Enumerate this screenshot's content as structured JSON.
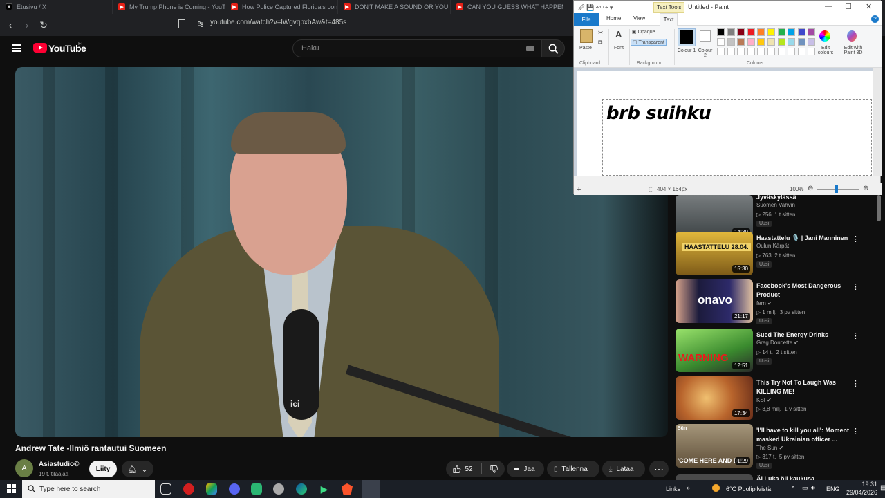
{
  "browser": {
    "tabs": [
      {
        "icon": "x-logo-icon",
        "title": "Etusivu / X"
      },
      {
        "icon": "youtube-icon",
        "title": "My Trump Phone is Coming - YouTu"
      },
      {
        "icon": "youtube-icon",
        "title": "How Police Captured Florida's Long"
      },
      {
        "icon": "youtube-icon",
        "title": "DON'T MAKE A SOUND OR YOU DIE"
      },
      {
        "icon": "youtube-icon",
        "title": "CAN YOU GUESS WHAT HAPPENS N"
      }
    ],
    "url": "youtube.com/watch?v=lWgvqpxbAw&t=485s"
  },
  "youtube": {
    "logo_text": "YouTube",
    "country": "FI",
    "search_placeholder": "Haku",
    "video": {
      "title": "Andrew Tate -Ilmiö rantautui Suomeen",
      "channel": "Asiastudio©",
      "subscribers": "19 t. tilaajaa",
      "join_label": "Liity",
      "likes": "52",
      "share_label": "Jaa",
      "save_label": "Tallenna",
      "download_label": "Lataa",
      "video_logo": "ici"
    },
    "sidebar": [
      {
        "title": "Jyväskylässä",
        "channel": "Suomen Vahvin",
        "views": "256",
        "age": "1 t sitten",
        "duration": "14:39",
        "badge": "Uusi",
        "verified": false,
        "thumb": "#5e6466"
      },
      {
        "title": "Haastattelu 🎙️ | Jani Manninen",
        "channel": "Oulun Kärpät",
        "views": "763",
        "age": "2 t sitten",
        "duration": "15:30",
        "badge": "Uusi",
        "verified": false,
        "thumb": "#c79b2b",
        "thumb_text": "HAASTATTELU 28.04."
      },
      {
        "title": "Facebook's Most Dangerous Product",
        "channel": "fern",
        "views": "1 milj.",
        "age": "3 pv sitten",
        "duration": "21:17",
        "badge": "Uusi",
        "verified": true,
        "thumb": "#1c1b3c",
        "thumb_text": "onavo"
      },
      {
        "title": "Sued The Energy Drinks",
        "channel": "Greg Doucette",
        "views": "14 t.",
        "age": "2 t sitten",
        "duration": "12:51",
        "badge": "Uusi",
        "verified": true,
        "thumb": "#5fb84a",
        "thumb_text": "WARNING"
      },
      {
        "title": "This Try Not To Laugh Was KILLING ME!",
        "channel": "KSI",
        "views": "3,8 milj.",
        "age": "1 v sitten",
        "duration": "17:34",
        "badge": "",
        "verified": true,
        "thumb": "#d8a340"
      },
      {
        "title": "'I'll have to kill you all': Moment masked Ukrainian officer ...",
        "channel": "The Sun",
        "views": "317 t.",
        "age": "5 pv sitten",
        "duration": "1:29",
        "badge": "Uusi",
        "verified": true,
        "thumb": "#7d6a4f",
        "thumb_text": "'COME HERE AND DIE",
        "thumb_label": "Sün"
      },
      {
        "title": "Äl Luka öli kaukusa",
        "channel": "",
        "views": "",
        "age": "",
        "duration": "",
        "badge": "",
        "verified": false,
        "thumb": "#4a4a4a"
      }
    ]
  },
  "paint": {
    "window_title": "Untitled - Paint",
    "context_tab": "Text Tools",
    "tabs": {
      "file": "File",
      "home": "Home",
      "view": "View",
      "text": "Text"
    },
    "ribbon": {
      "paste": "Paste",
      "font": "Font",
      "opaque": "Opaque",
      "transparent": "Transparent",
      "colour1": "Colour 1",
      "colour2": "Colour 2",
      "edit_colours": "Edit colours",
      "edit_paint3d": "Edit with Paint 3D",
      "group_clipboard": "Clipboard",
      "group_background": "Background",
      "group_colours": "Colours"
    },
    "palette": [
      "#000000",
      "#7f7f7f",
      "#880015",
      "#ed1c24",
      "#ff7f27",
      "#fff200",
      "#22b14c",
      "#00a2e8",
      "#3f48cc",
      "#a349a4",
      "#ffffff",
      "#c3c3c3",
      "#b97a57",
      "#ffaec9",
      "#ffc90e",
      "#efe4b0",
      "#b5e61d",
      "#99d9ea",
      "#7092be",
      "#c8bfe7"
    ],
    "canvas_text": "brb suihku",
    "selection_size": "404 × 164px",
    "zoom": "100%"
  },
  "taskbar": {
    "search_placeholder": "Type here to search",
    "links": "Links",
    "weather": "6°C  Puolipilvistä",
    "language": "ENG",
    "time": "19.31",
    "date": "29/04/2026"
  }
}
